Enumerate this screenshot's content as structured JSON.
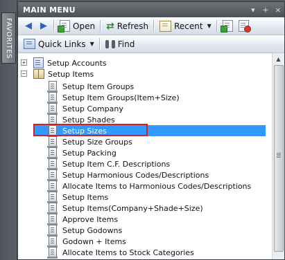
{
  "favorites_tab": "FAVORITES",
  "window": {
    "title": "MAIN MENU",
    "controls": [
      "▾",
      "+",
      "×"
    ]
  },
  "toolbar1": {
    "open": "Open",
    "refresh": "Refresh",
    "recent": "Recent"
  },
  "toolbar2": {
    "quick_links": "Quick Links",
    "find": "Find"
  },
  "tree": {
    "root1": "Setup Accounts",
    "root2": "Setup Items",
    "items": [
      "Setup Item Groups",
      "Setup Item Groups(Item+Size)",
      "Setup Company",
      "Setup Shades",
      "Setup Sizes",
      "Setup Size Groups",
      "Setup Packing",
      "Setup Item C.F. Descriptions",
      "Setup Harmonious Codes/Descriptions",
      "Allocate Items to Harmonious Codes/Descriptions",
      "Setup Items",
      "Setup Items(Company+Shade+Size)",
      "Approve Items",
      "Setup Godowns",
      "Godown + Items",
      "Allocate Items to Stock Categories"
    ],
    "selected_index": 4
  },
  "colors": {
    "selection": "#3399ff",
    "highlight_box": "#d42020",
    "titlebar": "#5a5f64"
  }
}
